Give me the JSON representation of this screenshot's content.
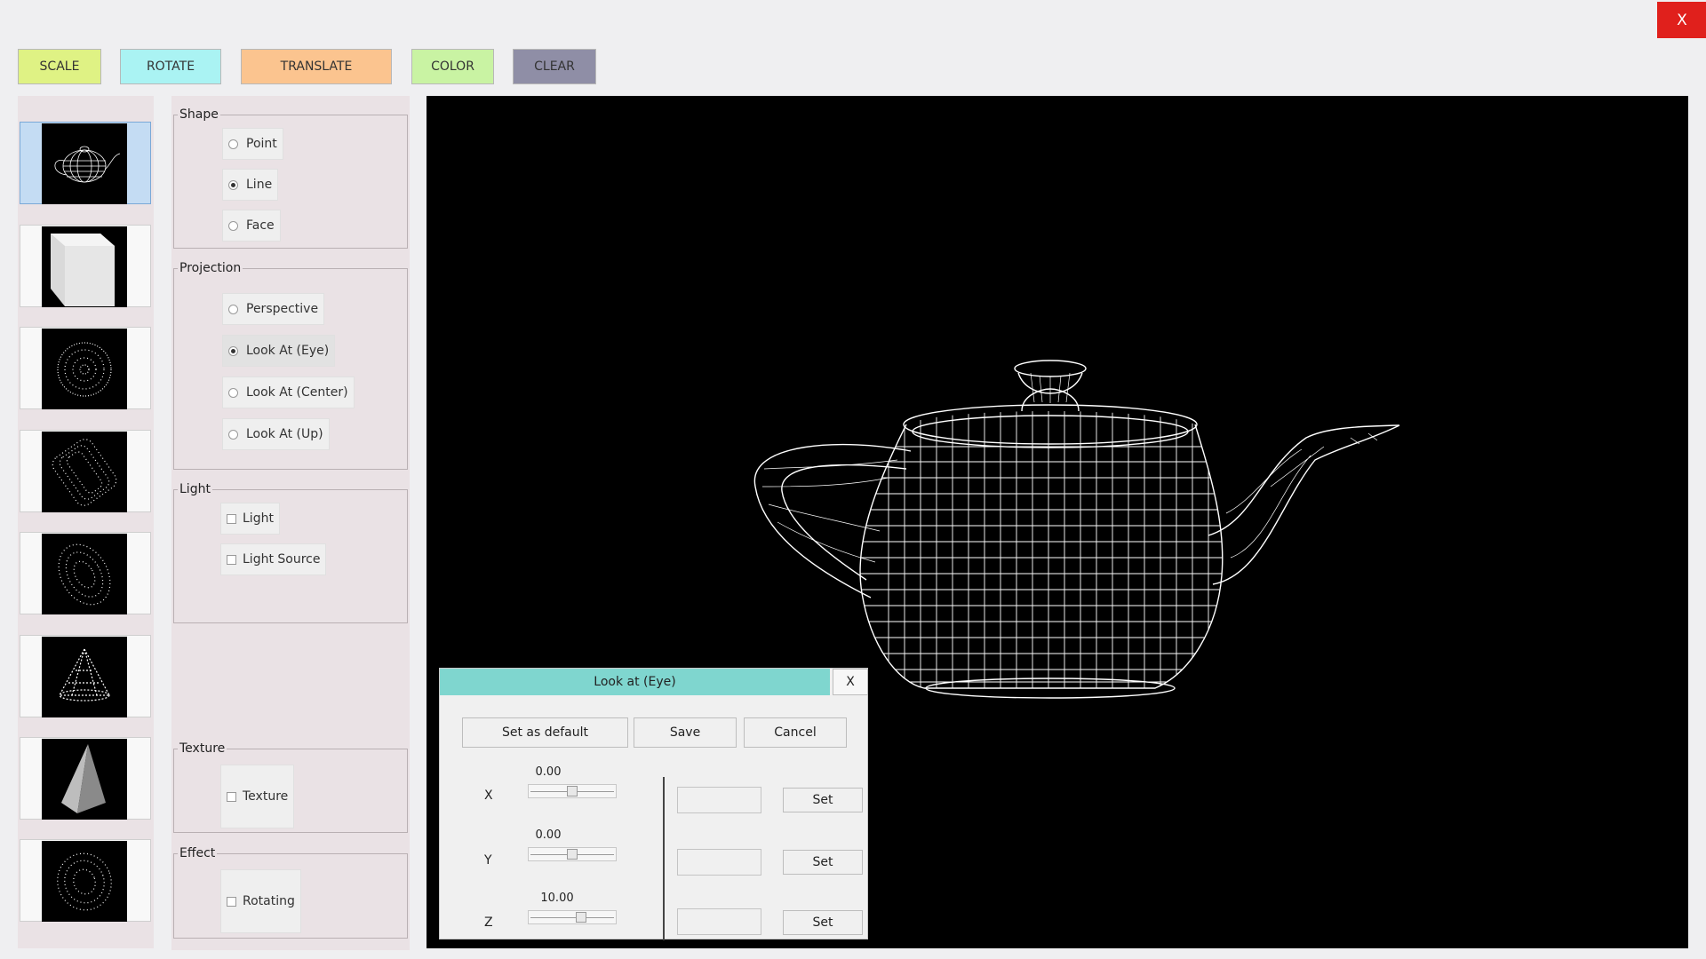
{
  "app": {
    "close_label": "X"
  },
  "toolbar": {
    "buttons": [
      {
        "label": "SCALE",
        "color": "#dff284"
      },
      {
        "label": "ROTATE",
        "color": "#aaf3f3"
      },
      {
        "label": "TRANSLATE",
        "color": "#fbc48f"
      },
      {
        "label": "COLOR",
        "color": "#c9f3a3"
      },
      {
        "label": "CLEAR",
        "color": "#8f8ea6"
      }
    ]
  },
  "models": {
    "items": [
      "teapot-wireframe",
      "cube",
      "sphere-points",
      "cylinder-points",
      "ellipsoid-points",
      "cone-points",
      "pyramid",
      "torus-points"
    ],
    "selected_index": 0
  },
  "shape": {
    "title": "Shape",
    "options": [
      {
        "label": "Point",
        "checked": false
      },
      {
        "label": "Line",
        "checked": true
      },
      {
        "label": "Face",
        "checked": false
      }
    ]
  },
  "projection": {
    "title": "Projection",
    "options": [
      {
        "label": "Perspective",
        "checked": false
      },
      {
        "label": "Look At (Eye)",
        "checked": true
      },
      {
        "label": "Look At (Center)",
        "checked": false
      },
      {
        "label": "Look At (Up)",
        "checked": false
      }
    ]
  },
  "light": {
    "title": "Light",
    "options": [
      {
        "label": "Light",
        "checked": false
      },
      {
        "label": "Light Source",
        "checked": false
      }
    ]
  },
  "texture": {
    "title": "Texture",
    "option": "Texture",
    "checked": false
  },
  "effect": {
    "title": "Effect",
    "option": "Rotating",
    "checked": false
  },
  "dialog": {
    "title": "Look at (Eye)",
    "close_label": "X",
    "set_default_label": "Set as default",
    "save_label": "Save",
    "cancel_label": "Cancel",
    "set_label": "Set",
    "axes": [
      {
        "label": "X",
        "value": "0.00",
        "slider_fraction": 0.5,
        "input": ""
      },
      {
        "label": "Y",
        "value": "0.00",
        "slider_fraction": 0.5,
        "input": ""
      },
      {
        "label": "Z",
        "value": "10.00",
        "slider_fraction": 0.62,
        "input": ""
      }
    ]
  }
}
